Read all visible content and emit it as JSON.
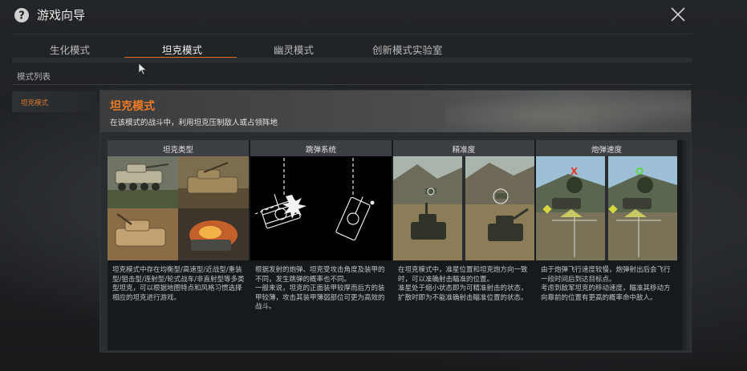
{
  "window": {
    "title": "游戏向导",
    "icon": "help-icon"
  },
  "tabs": [
    {
      "label": "生化模式",
      "active": false
    },
    {
      "label": "坦克模式",
      "active": true
    },
    {
      "label": "幽灵模式",
      "active": false
    },
    {
      "label": "创新模式实验室",
      "active": false
    }
  ],
  "list_header": "模式列表",
  "sidebar": {
    "items": [
      {
        "label": "坦克模式",
        "selected": true
      }
    ]
  },
  "mode": {
    "title": "坦克模式",
    "description": "在该模式的战斗中，利用坦克压制敌人或占领阵地"
  },
  "cards": [
    {
      "title": "坦克类型",
      "text": "坦克模式中存在均衡型/高速型/近战型/重装型/狙击型/连射型/轮式战车/非直射型等多类型坦克，可以根据地图特点和风格习惯选择相应的坦克进行游戏。"
    },
    {
      "title": "跳弹系统",
      "text": "根据发射的炮弹、坦克受攻击角度及装甲的不同，发生跳弹的概率也不同。\n一般来说，坦克的正面装甲较厚而后方的装甲较薄，攻击其装甲薄弱部位可更为高效的战斗。"
    },
    {
      "title": "精准度",
      "text": "在坦克模式中，准星位置和坦克炮方向一致时，可以准确射击瞄准的位置。\n准星处于缩小状态即为可精准射击的状态，扩散时即为不能准确射击瞄准位置的状态。"
    },
    {
      "title": "炮弹速度",
      "text": "由于炮弹飞行速度较慢，炮弹射出后会飞行一段时间后到达目标点。\n考虑到敌军坦克的移动速度，瞄准其移动方向靠前的位置有更高的概率命中敌人。",
      "marks": [
        "X",
        "O"
      ]
    }
  ],
  "colors": {
    "accent": "#e06a1e",
    "title_orange": "#ee7a25"
  }
}
